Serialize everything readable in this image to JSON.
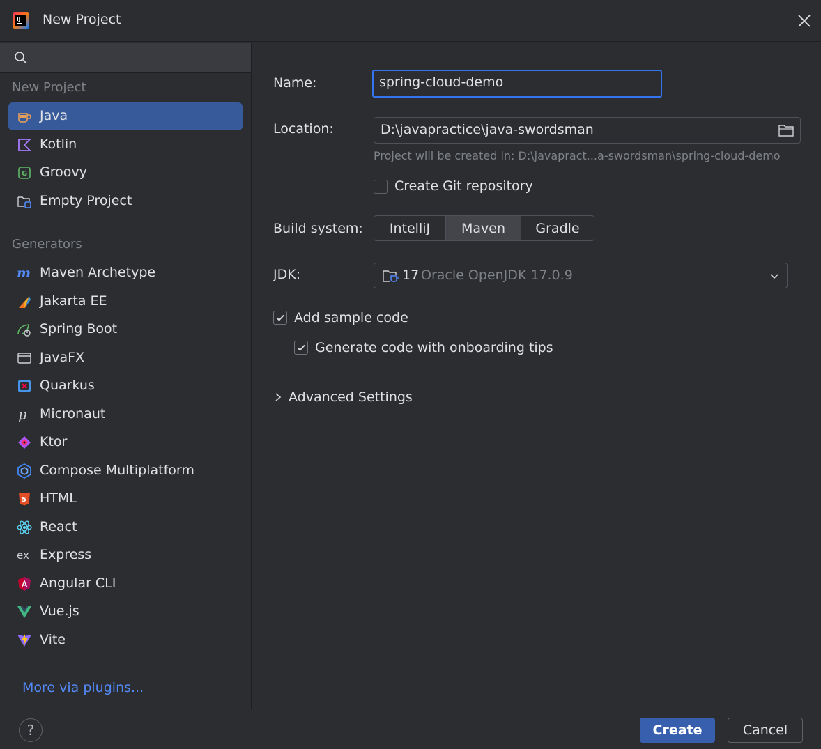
{
  "window": {
    "title": "New Project"
  },
  "sidebar": {
    "new_project_label": "New Project",
    "new_project_items": [
      {
        "label": "Java",
        "icon": "java-icon"
      },
      {
        "label": "Kotlin",
        "icon": "kotlin-icon"
      },
      {
        "label": "Groovy",
        "icon": "groovy-icon"
      },
      {
        "label": "Empty Project",
        "icon": "empty-project-icon"
      }
    ],
    "generators_label": "Generators",
    "generator_items": [
      {
        "label": "Maven Archetype",
        "icon": "maven-icon"
      },
      {
        "label": "Jakarta EE",
        "icon": "jakarta-ee-icon"
      },
      {
        "label": "Spring Boot",
        "icon": "spring-boot-icon"
      },
      {
        "label": "JavaFX",
        "icon": "javafx-icon"
      },
      {
        "label": "Quarkus",
        "icon": "quarkus-icon"
      },
      {
        "label": "Micronaut",
        "icon": "micronaut-icon"
      },
      {
        "label": "Ktor",
        "icon": "ktor-icon"
      },
      {
        "label": "Compose Multiplatform",
        "icon": "compose-icon"
      },
      {
        "label": "HTML",
        "icon": "html5-icon"
      },
      {
        "label": "React",
        "icon": "react-icon"
      },
      {
        "label": "Express",
        "icon": "express-icon"
      },
      {
        "label": "Angular CLI",
        "icon": "angular-icon"
      },
      {
        "label": "Vue.js",
        "icon": "vue-icon"
      },
      {
        "label": "Vite",
        "icon": "vite-icon"
      }
    ],
    "more_plugins": "More via plugins..."
  },
  "form": {
    "name_label": "Name:",
    "name_value": "spring-cloud-demo",
    "location_label": "Location:",
    "location_value": "D:\\javapractice\\java-swordsman",
    "location_hint": "Project will be created in: D:\\javapract...a-swordsman\\spring-cloud-demo",
    "git_label": "Create Git repository",
    "git_checked": false,
    "build_label": "Build system:",
    "build_options": [
      "IntelliJ",
      "Maven",
      "Gradle"
    ],
    "build_selected": "Maven",
    "jdk_label": "JDK:",
    "jdk_version": "17",
    "jdk_name": "Oracle OpenJDK 17.0.9",
    "sample_code_label": "Add sample code",
    "sample_code_checked": true,
    "onboarding_label": "Generate code with onboarding tips",
    "onboarding_checked": true,
    "advanced_label": "Advanced Settings"
  },
  "footer": {
    "help": "?",
    "create": "Create",
    "cancel": "Cancel"
  },
  "colors": {
    "background": "#2b2d30",
    "selection": "#375a9a",
    "accent": "#3574f0",
    "link": "#548af7",
    "muted_text": "#7f8287"
  }
}
